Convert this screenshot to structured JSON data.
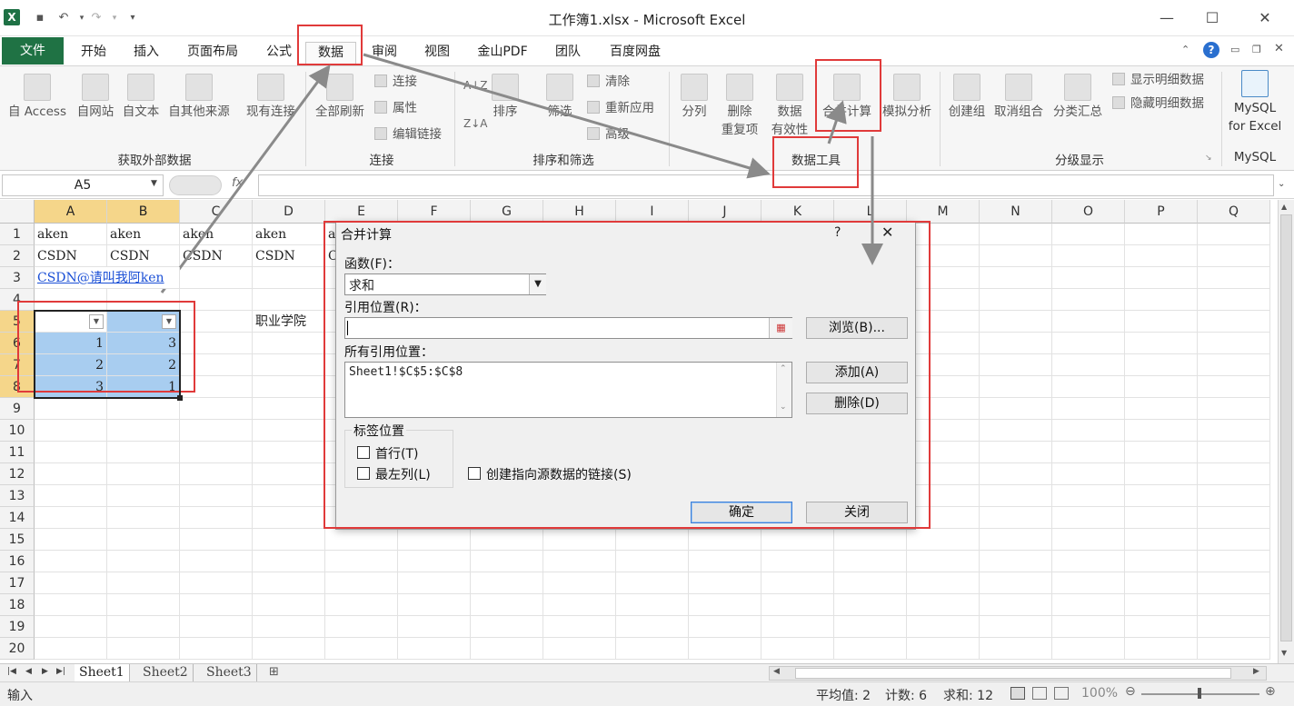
{
  "window": {
    "title": "工作簿1.xlsx - Microsoft Excel",
    "min": "—",
    "max": "☐",
    "close": "✕"
  },
  "tabs": {
    "file": "文件",
    "items": [
      "开始",
      "插入",
      "页面布局",
      "公式",
      "数据",
      "审阅",
      "视图",
      "金山PDF",
      "团队",
      "百度网盘"
    ]
  },
  "ribbon": {
    "get_external": {
      "access": "自 Access",
      "web": "自网站",
      "text": "自文本",
      "other": "自其他来源",
      "existing": "现有连接",
      "group": "获取外部数据"
    },
    "connections": {
      "refresh_all": "全部刷新",
      "connections": "连接",
      "properties": "属性",
      "edit_links": "编辑链接",
      "group": "连接"
    },
    "sort_filter": {
      "sort": "排序",
      "filter": "筛选",
      "clear": "清除",
      "reapply": "重新应用",
      "advanced": "高级",
      "group": "排序和筛选"
    },
    "data_tools": {
      "text_to_columns": "分列",
      "remove_dup_1": "删除",
      "remove_dup_2": "重复项",
      "validation_1": "数据",
      "validation_2": "有效性",
      "consolidate": "合并计算",
      "what_if": "模拟分析",
      "group": "数据工具"
    },
    "outline": {
      "group_btn": "创建组",
      "ungroup": "取消组合",
      "subtotal": "分类汇总",
      "show_detail": "显示明细数据",
      "hide_detail": "隐藏明细数据",
      "group": "分级显示"
    },
    "mysql": {
      "btn_1": "MySQL",
      "btn_2": "for Excel",
      "group": "MySQL"
    }
  },
  "formula_bar": {
    "name_box": "A5",
    "fx": "fx",
    "value": ""
  },
  "grid": {
    "columns": [
      "A",
      "B",
      "C",
      "D",
      "E",
      "F",
      "G",
      "H",
      "I",
      "J",
      "K",
      "L",
      "M",
      "N",
      "O",
      "P",
      "Q"
    ],
    "rows": [
      "1",
      "2",
      "3",
      "4",
      "5",
      "6",
      "7",
      "8",
      "9",
      "10",
      "11",
      "12",
      "13",
      "14",
      "15",
      "16",
      "17",
      "18",
      "19",
      "20"
    ],
    "row1": [
      "aken",
      "aken",
      "aken",
      "aken",
      "a"
    ],
    "row2": [
      "CSDN",
      "CSDN",
      "CSDN",
      "CSDN",
      "C"
    ],
    "row3_link": "CSDN@请叫我阿ken",
    "d5": "职业学院",
    "a6": "1",
    "b6": "3",
    "a7": "2",
    "b7": "2",
    "a8": "3",
    "b8": "1"
  },
  "sheets": {
    "tabs": [
      "Sheet1",
      "Sheet2",
      "Sheet3"
    ]
  },
  "status": {
    "mode": "输入",
    "average": "平均值: 2",
    "count": "计数: 6",
    "sum": "求和: 12",
    "zoom": "100%"
  },
  "dialog": {
    "title": "合并计算",
    "help": "?",
    "close_x": "✕",
    "function_label": "函数(F)：",
    "function_value": "求和",
    "ref_label": "引用位置(R)：",
    "ref_value": "",
    "browse": "浏览(B)...",
    "all_refs_label": "所有引用位置：",
    "all_refs": [
      "Sheet1!$C$5:$C$8"
    ],
    "add": "添加(A)",
    "delete": "删除(D)",
    "labels_group": "标签位置",
    "top_row": "首行(T)",
    "left_col": "最左列(L)",
    "create_links": "创建指向源数据的链接(S)",
    "ok": "确定",
    "close": "关闭"
  },
  "colors": {
    "excel_green": "#1f7244",
    "selected_header": "#f5d68a",
    "cell_highlight": "#a8cdf0",
    "annotation_red": "#e03a3a"
  }
}
